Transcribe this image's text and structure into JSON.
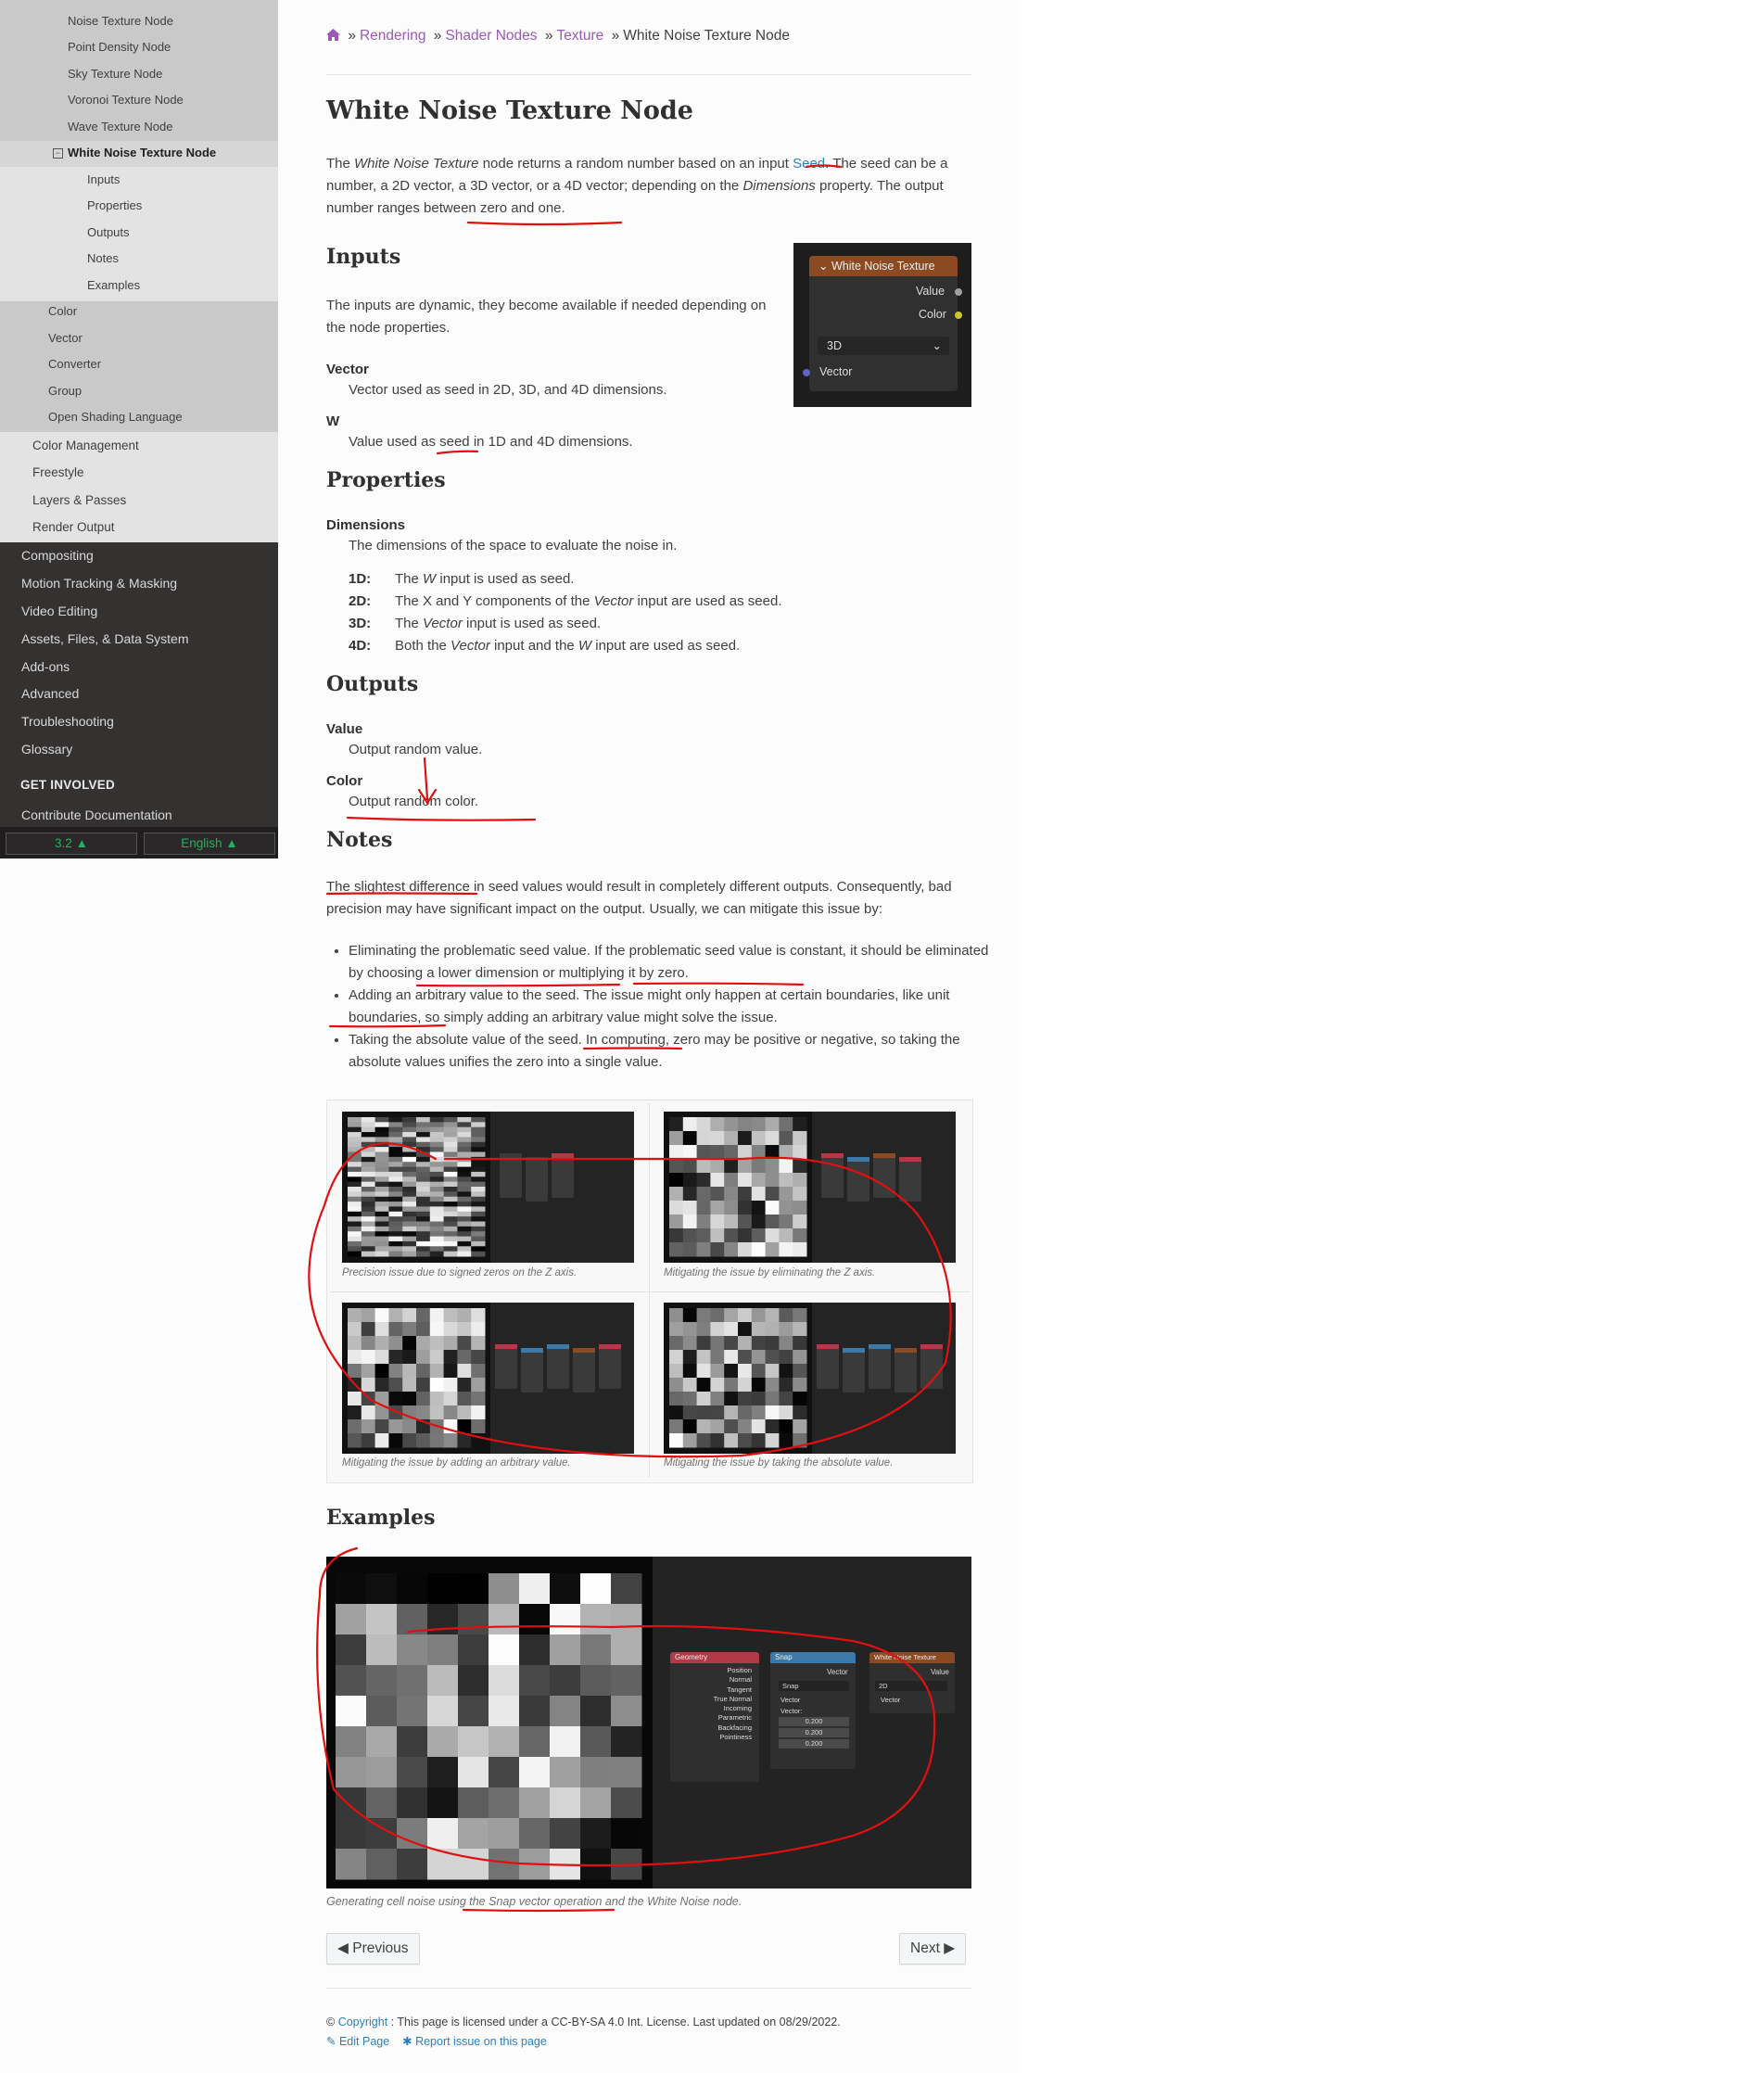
{
  "sidebar": {
    "items_l3_top": [
      "Noise Texture Node",
      "Point Density Node",
      "Sky Texture Node",
      "Voronoi Texture Node",
      "Wave Texture Node"
    ],
    "current_item": "White Noise Texture Node",
    "items_l4": [
      "Inputs",
      "Properties",
      "Outputs",
      "Notes",
      "Examples"
    ],
    "items_l3_bottom": [
      "Color",
      "Vector",
      "Converter",
      "Group",
      "Open Shading Language"
    ],
    "items_l2": [
      "Color Management",
      "Freestyle",
      "Layers & Passes",
      "Render Output"
    ],
    "items_l1": [
      "Compositing",
      "Motion Tracking & Masking",
      "Video Editing",
      "Assets, Files, & Data System",
      "Add-ons",
      "Advanced",
      "Troubleshooting",
      "Glossary"
    ],
    "get_involved": "GET INVOLVED",
    "contribute": "Contribute Documentation",
    "version": "3.2",
    "language": "English"
  },
  "breadcrumb": {
    "home_icon": "home-icon",
    "items": [
      "Rendering",
      "Shader Nodes",
      "Texture"
    ],
    "current": "White Noise Texture Node"
  },
  "page": {
    "title": "White Noise Texture Node",
    "intro": {
      "p1": "The ",
      "em1": "White Noise Texture",
      "p2": " node returns a random number based on an input ",
      "link": "Seed",
      "p3": ". The seed can be a number, a 2D vector, a 3D vector, or a 4D vector; depending on the ",
      "em2": "Dimensions",
      "p4": " property. The output number ranges between zero and one."
    },
    "inputs": {
      "heading": "Inputs",
      "text": "The inputs are dynamic, they become available if needed depending on the node properties.",
      "vector_term": "Vector",
      "vector_desc": "Vector used as seed in 2D, 3D, and 4D dimensions.",
      "w_term": "W",
      "w_desc": "Value used as seed in 1D and 4D dimensions."
    },
    "properties": {
      "heading": "Properties",
      "term": "Dimensions",
      "desc": "The dimensions of the space to evaluate the noise in.",
      "dims": [
        {
          "key": "1D:",
          "a": "The ",
          "em": "W",
          "b": " input is used as seed.",
          "c": "",
          "em2": "",
          "d": ""
        },
        {
          "key": "2D:",
          "a": "The X and Y components of the ",
          "em": "Vector",
          "b": " input are used as seed.",
          "c": "",
          "em2": "",
          "d": ""
        },
        {
          "key": "3D:",
          "a": "The ",
          "em": "Vector",
          "b": " input is used as seed.",
          "c": "",
          "em2": "",
          "d": ""
        },
        {
          "key": "4D:",
          "a": "Both the ",
          "em": "Vector",
          "b": " input and the ",
          "c": "",
          "em2": "W",
          "d": " input are used as seed."
        }
      ]
    },
    "outputs": {
      "heading": "Outputs",
      "value_term": "Value",
      "value_desc": "Output random value.",
      "color_term": "Color",
      "color_desc": "Output random color."
    },
    "notes": {
      "heading": "Notes",
      "text": "The slightest difference in seed values would result in completely different outputs. Consequently, bad precision may have significant impact on the output. Usually, we can mitigate this issue by:",
      "bullets": [
        "Eliminating the problematic seed value. If the problematic seed value is constant, it should be eliminated by choosing a lower dimension or multiplying it by zero.",
        "Adding an arbitrary value to the seed. The issue might only happen at certain boundaries, like unit boundaries, so simply adding an arbitrary value might solve the issue.",
        "Taking the absolute value of the seed. In computing, zero may be positive or negative, so taking the absolute values unifies the zero into a single value."
      ],
      "captions": [
        "Precision issue due to signed zeros on the Z axis.",
        "Mitigating the issue by eliminating the Z axis.",
        "Mitigating the issue by adding an arbitrary value.",
        "Mitigating the issue by taking the absolute value."
      ]
    },
    "examples": {
      "heading": "Examples",
      "caption_a": "Generating cell noise using the ",
      "caption_em": "Snap",
      "caption_b": " vector operation and the White Noise node."
    }
  },
  "node_widget": {
    "title": "White Noise Texture",
    "out_value": "Value",
    "out_color": "Color",
    "dimension": "3D",
    "in_vector": "Vector",
    "header_color": "#8b4a21"
  },
  "example_nodes": {
    "geometry_title": "Geometry",
    "geometry_outputs": [
      "Position",
      "Normal",
      "Tangent",
      "True Normal",
      "Incoming",
      "Parametric",
      "Backfacing",
      "Pointiness"
    ],
    "snap_title": "Snap",
    "snap_out": "Vector",
    "snap_op": "Snap",
    "snap_in": "Vector",
    "snap_inc": "Vector:",
    "snap_vals": [
      "0.200",
      "0.200",
      "0.200"
    ],
    "wn_title": "White Noise Texture",
    "wn_out": "Value",
    "wn_dim": "2D",
    "wn_in": "Vector"
  },
  "nav_buttons": {
    "previous": "Previous",
    "next": "Next"
  },
  "footer": {
    "copyright_link": "Copyright",
    "copyright_text": ": This page is licensed under a CC-BY-SA 4.0 Int. License. Last updated on 08/29/2022.",
    "edit": "Edit Page",
    "report": "Report issue on this page"
  },
  "colors": {
    "link": "#2980b9",
    "crumb_link": "#9b59b6",
    "annotation": "#e01010",
    "sidebar_dark": "#343131"
  }
}
